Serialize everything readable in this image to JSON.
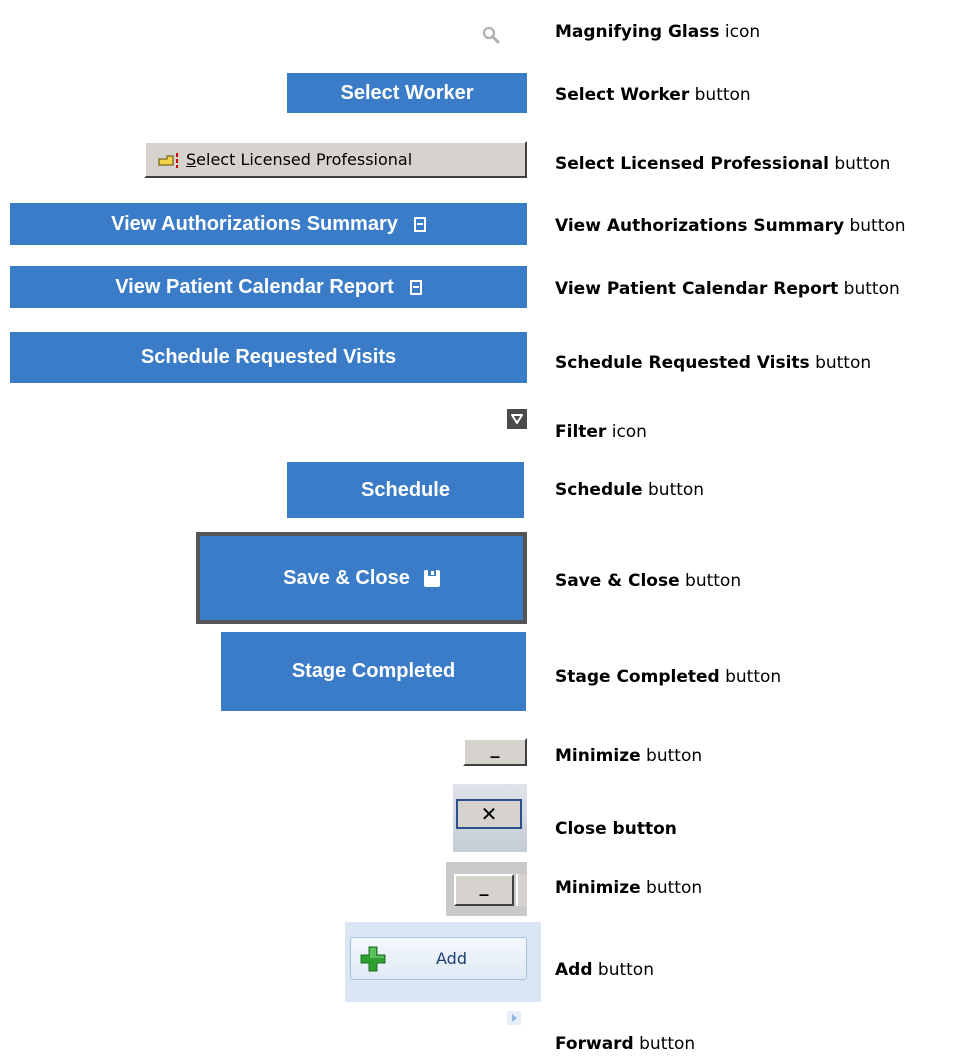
{
  "items": [
    {
      "control": {
        "type": "icon",
        "name": "Magnifying Glass"
      },
      "label_bold": "Magnifying Glass",
      "label_rest": " icon"
    },
    {
      "control": {
        "type": "button",
        "text": "Select Worker"
      },
      "label_bold": "Select Worker",
      "label_rest": " button"
    },
    {
      "control": {
        "type": "button",
        "text": "Select Licensed Professional",
        "underlined_char": "S",
        "text_rest": "elect Licensed Professional"
      },
      "label_bold": "Select Licensed Professional",
      "label_rest": " button"
    },
    {
      "control": {
        "type": "button",
        "text": "View Authorizations Summary"
      },
      "label_bold": "View Authorizations Summary",
      "label_rest": " button"
    },
    {
      "control": {
        "type": "button",
        "text": "View Patient Calendar Report"
      },
      "label_bold": "View Patient Calendar Report",
      "label_rest": " button"
    },
    {
      "control": {
        "type": "button",
        "text": "Schedule Requested Visits"
      },
      "label_bold": "Schedule Requested Visits",
      "label_rest": " button"
    },
    {
      "control": {
        "type": "icon",
        "name": "Filter"
      },
      "label_bold": "Filter",
      "label_rest": " icon"
    },
    {
      "control": {
        "type": "button",
        "text": "Schedule"
      },
      "label_bold": "Schedule",
      "label_rest": " button"
    },
    {
      "control": {
        "type": "button",
        "text": "Save & Close"
      },
      "label_bold": "Save & Close",
      "label_rest": " button"
    },
    {
      "control": {
        "type": "button",
        "text": "Stage Completed"
      },
      "label_bold": "Stage Completed",
      "label_rest": " button"
    },
    {
      "control": {
        "type": "button",
        "glyph": "_"
      },
      "label_bold": "Minimize",
      "label_rest": " button"
    },
    {
      "control": {
        "type": "button",
        "glyph": "✕"
      },
      "label_bold": "Close button",
      "label_rest": ""
    },
    {
      "control": {
        "type": "button",
        "glyph": "_"
      },
      "label_bold": "Minimize",
      "label_rest": " button"
    },
    {
      "control": {
        "type": "button",
        "text": "Add"
      },
      "label_bold": "Add",
      "label_rest": " button"
    },
    {
      "control": {
        "type": "icon",
        "name": "Forward"
      },
      "label_bold": "Forward",
      "label_rest": " button"
    }
  ],
  "colors": {
    "button_blue": "#3a7cc7",
    "button_grey": "#d6d3ce",
    "icon_grey": "#b0b0b0",
    "filter_dark": "#4a4a4a",
    "add_green": "#2e9e2e",
    "forward_blue": "#8fb3e0"
  }
}
